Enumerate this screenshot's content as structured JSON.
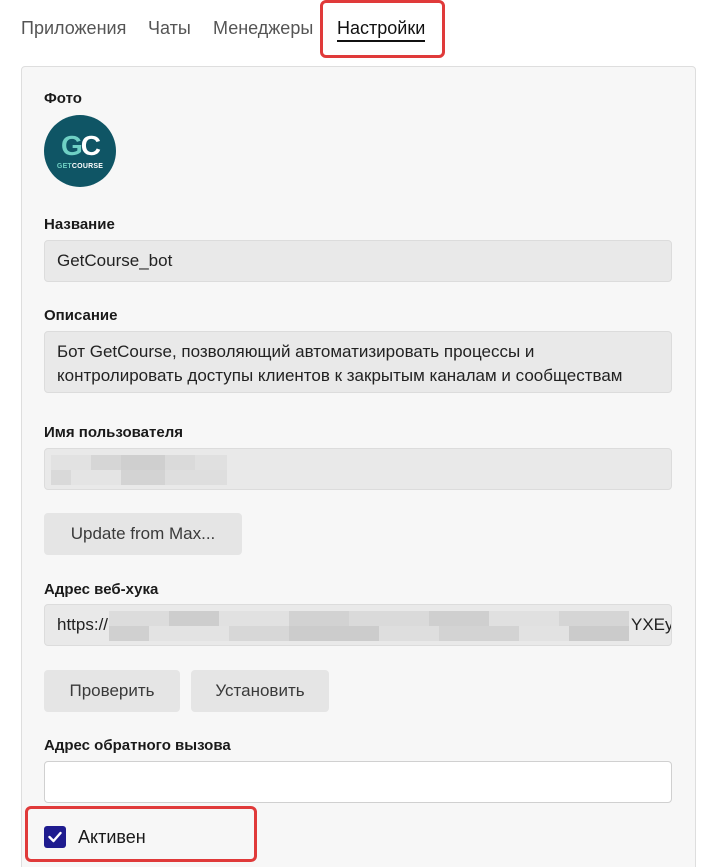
{
  "tabs": [
    {
      "label": "Приложения"
    },
    {
      "label": "Чаты"
    },
    {
      "label": "Менеджеры"
    },
    {
      "label": "Настройки"
    }
  ],
  "active_tab": "Настройки",
  "settings": {
    "photo_label": "Фото",
    "avatar": {
      "mono_g": "G",
      "mono_c": "C",
      "sub_get": "GET",
      "sub_course": "COURSE"
    },
    "name_label": "Название",
    "name_value": "GetCourse_bot",
    "description_label": "Описание",
    "description_value": "Бот GetCourse, позволяющий автоматизировать процессы и контролировать доступы клиентов к закрытым каналам и сообществам",
    "username_label": "Имя пользователя",
    "update_button": "Update from Max...",
    "webhook_label": "Адрес веб-хука",
    "webhook_prefix": "https://",
    "webhook_suffix": "YXEy",
    "check_button": "Проверить",
    "install_button": "Установить",
    "callback_label": "Адрес обратного вызова",
    "callback_value": "",
    "active_label": "Активен",
    "active_checked": true
  },
  "colors": {
    "highlight": "#e03a3a",
    "checkbox": "#1f1c8f",
    "avatar_bg": "#0f5565",
    "avatar_accent": "#6fd0c4"
  }
}
